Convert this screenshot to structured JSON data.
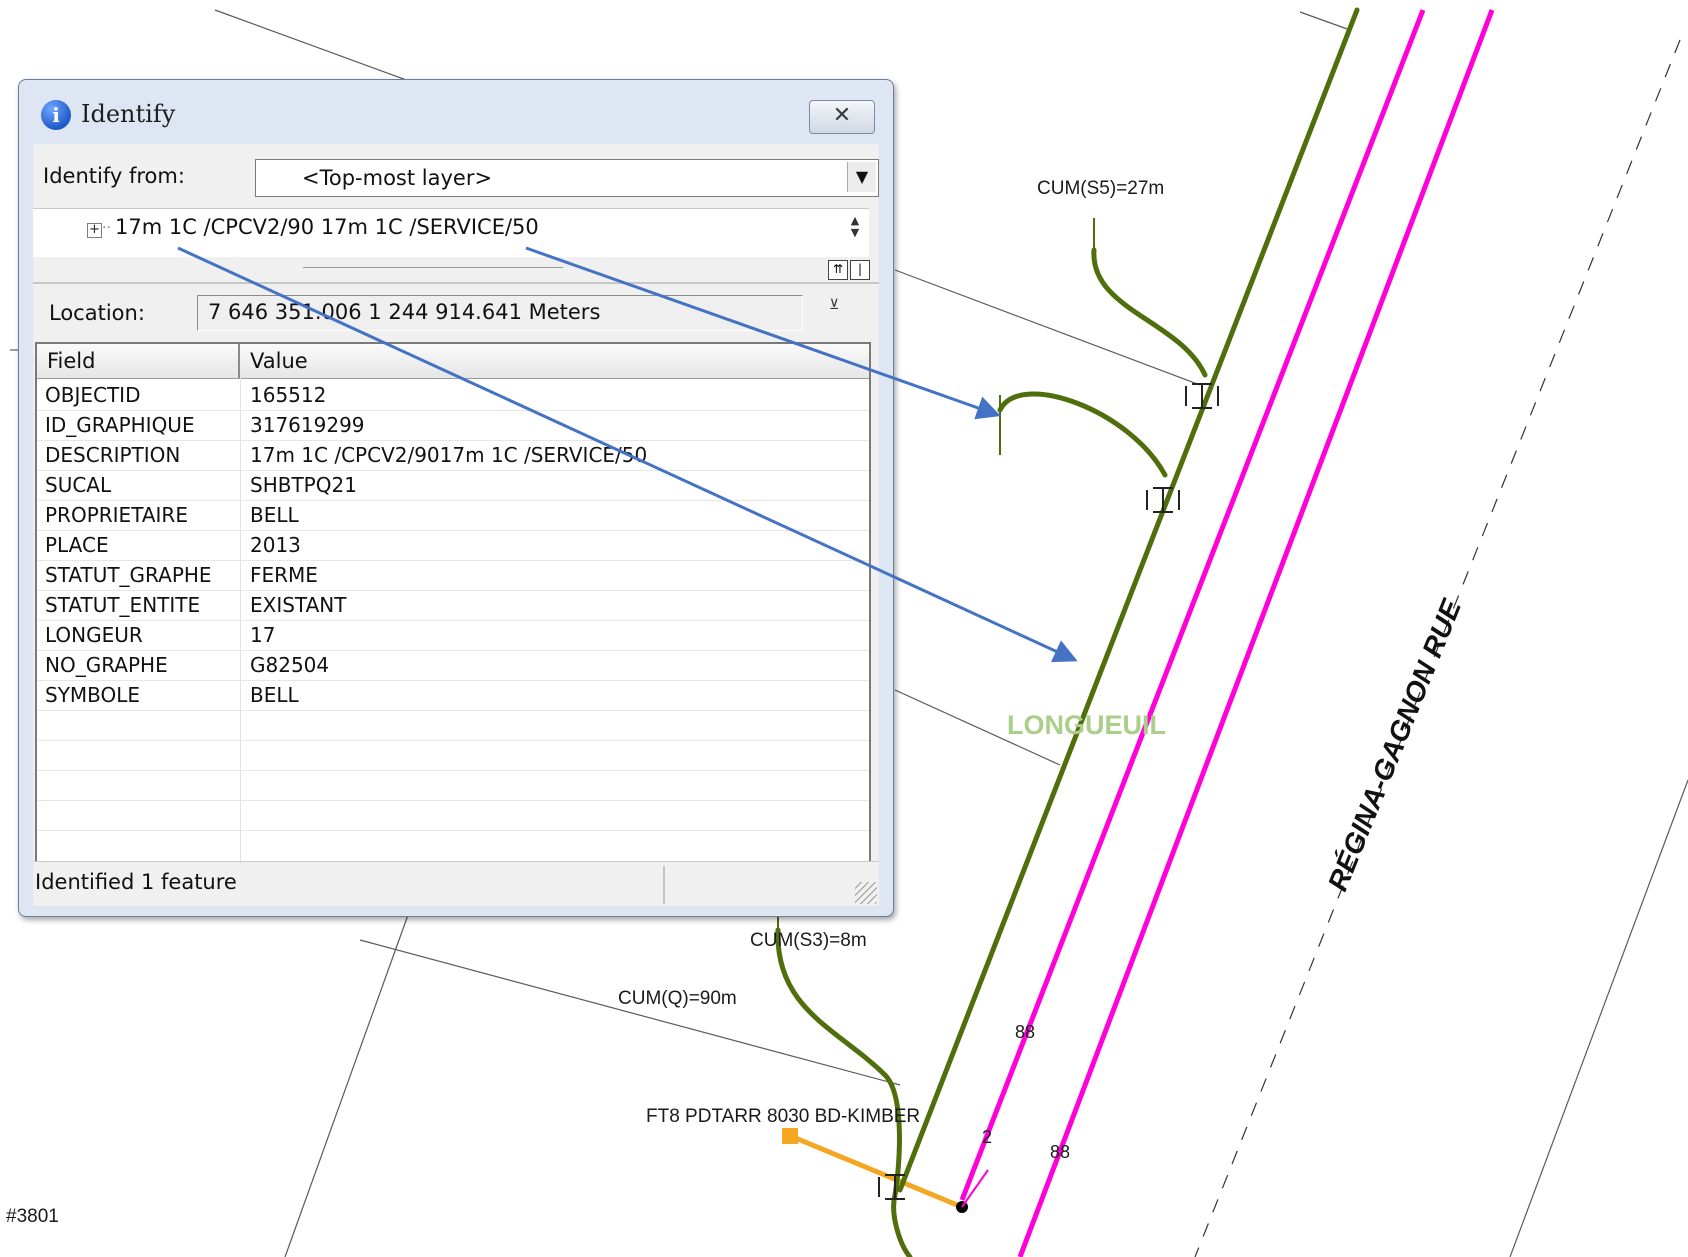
{
  "window": {
    "title": "Identify",
    "close_symbol": "✕"
  },
  "identify_from": {
    "label": "Identify from:",
    "value": "<Top-most layer>"
  },
  "tree": {
    "expander": "+",
    "item": "17m 1C /CPCV2/90 17m 1C /SERVICE/50"
  },
  "location": {
    "label": "Location:",
    "value": "7 646 351.006  1 244 914.641 Meters"
  },
  "table": {
    "headers": [
      "Field",
      "Value"
    ],
    "rows": [
      [
        "OBJECTID",
        "165512"
      ],
      [
        "ID_GRAPHIQUE",
        "317619299"
      ],
      [
        "DESCRIPTION",
        "17m 1C /CPCV2/9017m 1C /SERVICE/50"
      ],
      [
        "SUCAL",
        "SHBTPQ21"
      ],
      [
        "PROPRIETAIRE",
        "BELL"
      ],
      [
        "PLACE",
        "2013"
      ],
      [
        "STATUT_GRAPHE",
        "FERME"
      ],
      [
        "STATUT_ENTITE",
        "EXISTANT"
      ],
      [
        "LONGEUR",
        "17"
      ],
      [
        "NO_GRAPHE",
        "G82504"
      ],
      [
        "SYMBOLE",
        "BELL"
      ]
    ]
  },
  "status": {
    "text": "Identified 1 feature"
  },
  "map": {
    "labels": {
      "cum_s5": "CUM(S5)=27m",
      "cum_s3": "CUM(S3)=8m",
      "cum_q": "CUM(Q)=90m",
      "ft8": "FT8 PDTARR 8030 BD-KIMBER",
      "longueuil": "LONGUEUIL",
      "street": "RÉGINA-GAGNON RUE",
      "num88a": "88",
      "num88b": "88",
      "num2": "2",
      "edge": "#3801"
    },
    "colors": {
      "cable": "#4f6e0c",
      "road": "#ff00d8",
      "service": "#f5a623",
      "arrow": "#4472c4",
      "parcel": "#5a5a5a"
    }
  }
}
